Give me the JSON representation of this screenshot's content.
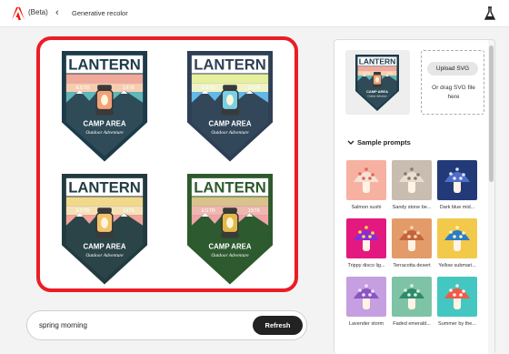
{
  "header": {
    "beta": "(Beta)",
    "breadcrumb": "Generative recolor"
  },
  "badge": {
    "title": "LANTERN",
    "estb": "ESTB",
    "year": "1978",
    "camp": "CAMP AREA",
    "sub": "Outdoor Adventure"
  },
  "variants": [
    {
      "bg": "#ffffff",
      "top": "#1d3b4a",
      "band1": "#f0a99a",
      "band2": "#f7cdb0",
      "sky": "#5fb7b9",
      "mtn": "#2f4b57",
      "lamp": "#f2a17a",
      "title": "#1d3b4a"
    },
    {
      "bg": "#ffffff",
      "top": "#2f3f55",
      "band1": "#e6ef9b",
      "band2": "#f0f3c7",
      "sky": "#62b9e8",
      "mtn": "#33475a",
      "lamp": "#79d0e6",
      "title": "#2f3f55"
    },
    {
      "bg": "#ffffff",
      "top": "#223b41",
      "band1": "#f2d98a",
      "band2": "#f4e2b6",
      "sky": "#f2a39a",
      "mtn": "#2b4447",
      "lamp": "#f4c36e",
      "title": "#223b41"
    },
    {
      "bg": "#ffffff",
      "top": "#2c5a2c",
      "band1": "#d9c38a",
      "band2": "#eeb7b0",
      "sky": "#f0a4a8",
      "mtn": "#2e5a30",
      "lamp": "#e3b84a",
      "title": "#2c5a2c"
    }
  ],
  "prompt": {
    "value": "spring morning",
    "refresh_label": "Refresh"
  },
  "panel": {
    "upload_label": "Upload SVG",
    "upload_hint": "Or drag SVG file here",
    "section_title": "Sample prompts",
    "samples": [
      {
        "label": "Salmon sushi",
        "bg": "#f6b1a1",
        "cap": "#f6e1d8",
        "dot": "#e2664f"
      },
      {
        "label": "Sandy stone be...",
        "bg": "#c9bcb0",
        "cap": "#e9ddd0",
        "dot": "#8a7666"
      },
      {
        "label": "Dark blue mid...",
        "bg": "#233a78",
        "cap": "#4f6fc6",
        "dot": "#dfe6ff"
      },
      {
        "label": "Trippy disco lig...",
        "bg": "#e4197f",
        "cap": "#8a2bd8",
        "dot": "#ffe04a"
      },
      {
        "label": "Terracotta desert",
        "bg": "#e49b6a",
        "cap": "#c5643c",
        "dot": "#f7d7b6"
      },
      {
        "label": "Yellow submari...",
        "bg": "#f2c94a",
        "cap": "#2b7cc9",
        "dot": "#fff4b0"
      },
      {
        "label": "Lavender storm",
        "bg": "#c59fe0",
        "cap": "#8b55c2",
        "dot": "#efe2ff"
      },
      {
        "label": "Faded emerald...",
        "bg": "#7fc3a6",
        "cap": "#2f8a6a",
        "dot": "#d8f2e6"
      },
      {
        "label": "Summer by the...",
        "bg": "#45c7c1",
        "cap": "#f05a4a",
        "dot": "#fff2e5"
      }
    ]
  },
  "colors": {
    "accent": "#ec1c24",
    "adobe_red": "#fa0f00"
  }
}
